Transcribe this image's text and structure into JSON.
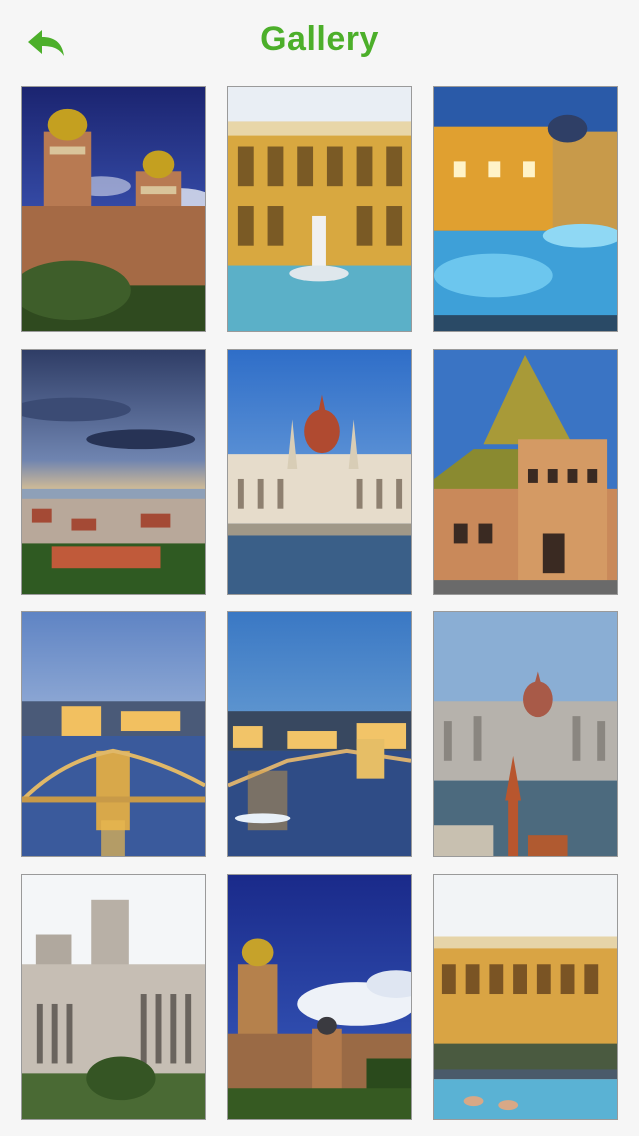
{
  "header": {
    "title": "Gallery",
    "back_icon": "back-arrow-icon"
  },
  "colors": {
    "accent": "#4caf2a",
    "background": "#f6f6f6",
    "tile_border": "#9a9a9a"
  },
  "gallery": {
    "photos": [
      {
        "subject": "synagogue-towers"
      },
      {
        "subject": "thermal-bath-fountain"
      },
      {
        "subject": "bath-pools-evening"
      },
      {
        "subject": "city-sunset-panorama"
      },
      {
        "subject": "parliament-river"
      },
      {
        "subject": "market-hall-tiled-roof"
      },
      {
        "subject": "chain-bridge-dusk"
      },
      {
        "subject": "chain-bridge-night"
      },
      {
        "subject": "parliament-from-hill"
      },
      {
        "subject": "classical-building"
      },
      {
        "subject": "synagogue-tower-clouds"
      },
      {
        "subject": "bath-courtyard"
      }
    ]
  }
}
